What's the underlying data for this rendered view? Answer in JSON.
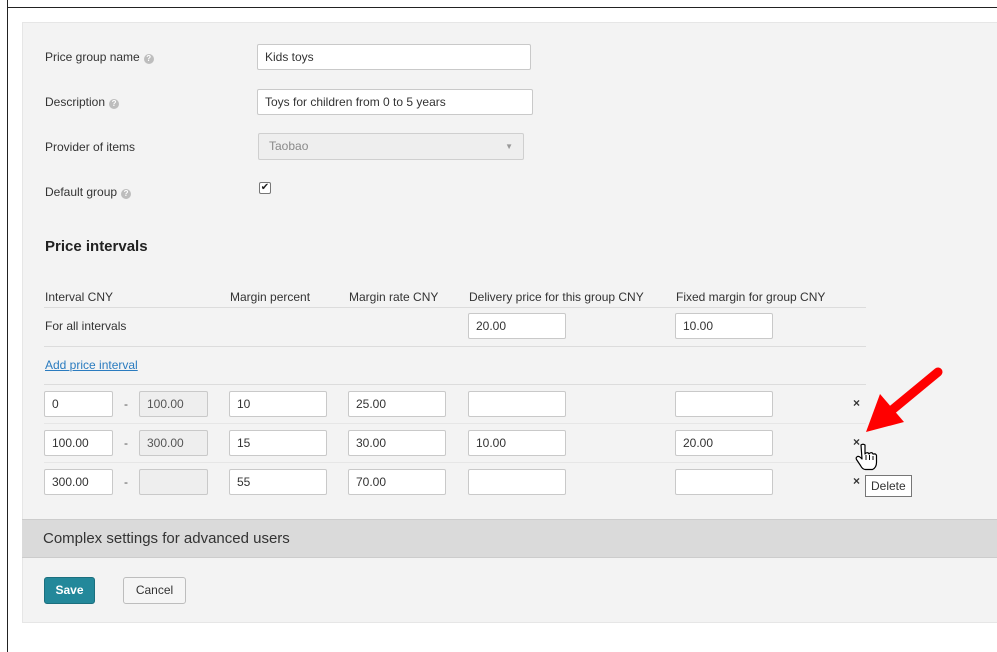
{
  "form": {
    "name_label": "Price group name",
    "name_value": "Kids toys",
    "description_label": "Description",
    "description_value": "Toys for children from 0 to 5 years",
    "provider_label": "Provider of items",
    "provider_value": "Taobao",
    "default_label": "Default group",
    "default_checked": true
  },
  "intervals": {
    "heading": "Price intervals",
    "columns": [
      "Interval CNY",
      "Margin percent",
      "Margin rate CNY",
      "Delivery price for this group CNY",
      "Fixed margin for group CNY"
    ],
    "all_label": "For all intervals",
    "all_delivery": "20.00",
    "all_fixed": "10.00",
    "add_link": "Add price interval",
    "separator": "-",
    "rows": [
      {
        "from": "0",
        "to": "100.00",
        "percent": "10",
        "rate": "25.00",
        "delivery": "",
        "fixed": ""
      },
      {
        "from": "100.00",
        "to": "300.00",
        "percent": "15",
        "rate": "30.00",
        "delivery": "10.00",
        "fixed": "20.00"
      },
      {
        "from": "300.00",
        "to": "",
        "percent": "55",
        "rate": "70.00",
        "delivery": "",
        "fixed": ""
      }
    ],
    "delete_icon": "×",
    "delete_tooltip": "Delete"
  },
  "complex": {
    "label": "Complex settings for advanced users"
  },
  "buttons": {
    "save": "Save",
    "cancel": "Cancel"
  },
  "colors": {
    "accent": "#23889a",
    "link": "#2a7bbf",
    "annotation_arrow": "#ff0000"
  },
  "icons": {
    "help": "question-circle-icon",
    "delete": "close-icon",
    "checkbox": "check-icon",
    "cursor": "hand-pointer-icon",
    "annotation": "red-arrow-icon"
  }
}
